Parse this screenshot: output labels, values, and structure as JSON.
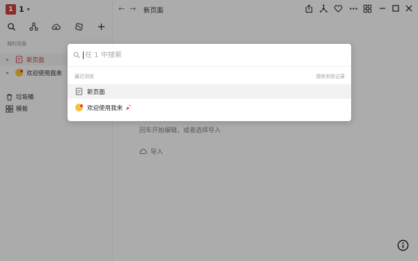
{
  "workspace": {
    "badge": "1",
    "name": "1"
  },
  "sidebar": {
    "section_label": "我的页面",
    "pages": [
      {
        "title": "新页面",
        "active": true
      },
      {
        "title": "欢迎使用我来",
        "active": false
      }
    ],
    "trash_label": "垃圾桶",
    "templates_label": "模板"
  },
  "topbar": {
    "page_title": "新页面"
  },
  "editor": {
    "hint": "回车开始编辑，或者选择导入",
    "import_label": "导入"
  },
  "search": {
    "placeholder": "在 1 中搜索",
    "recent_label": "最近浏览",
    "clear_label": "清除浏览记录",
    "results": [
      {
        "title": "新页面",
        "icon": "page-icon"
      },
      {
        "title": "欢迎使用我来",
        "icon": "emoji-kiss-icon"
      }
    ]
  },
  "colors": {
    "accent": "#c7403f",
    "overlay": "rgba(0,0,0,0.3)"
  }
}
